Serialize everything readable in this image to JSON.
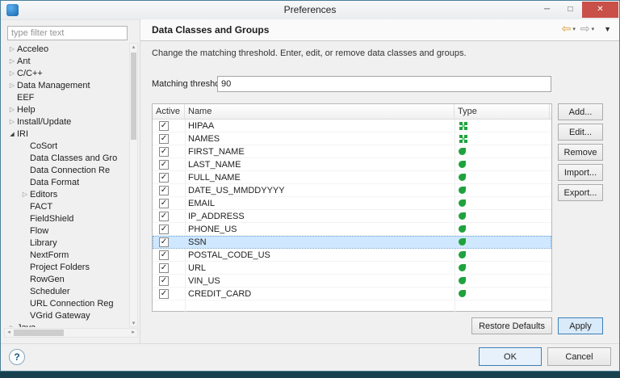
{
  "window": {
    "title": "Preferences",
    "controls": {
      "minimize": "─",
      "maximize": "□",
      "close": "✕"
    }
  },
  "icons": {
    "back": "⇦",
    "forward": "⇨",
    "caret_down": "▾",
    "view_menu": "▼",
    "help": "?",
    "check": "✓",
    "scroll_up": "▴",
    "scroll_down": "▾",
    "scroll_left": "◂",
    "scroll_right": "▸",
    "twisty_collapsed": "▷",
    "twisty_expanded": "◢"
  },
  "colors": {
    "accent": "#3e7fb6",
    "selection_bg": "#cfe8ff",
    "selection_border": "#6ba5dd",
    "class_icon_green": "#1fa23d",
    "close_button_red": "#c85048",
    "back_arrow_gold": "#d49a2a"
  },
  "sidebar": {
    "filter": {
      "value": "",
      "placeholder": "type filter text"
    },
    "tree": [
      {
        "label": "Acceleo",
        "level": 0,
        "state": "collapsed"
      },
      {
        "label": "Ant",
        "level": 0,
        "state": "collapsed"
      },
      {
        "label": "C/C++",
        "level": 0,
        "state": "collapsed"
      },
      {
        "label": "Data Management",
        "level": 0,
        "state": "collapsed"
      },
      {
        "label": "EEF",
        "level": 0,
        "state": "none"
      },
      {
        "label": "Help",
        "level": 0,
        "state": "collapsed"
      },
      {
        "label": "Install/Update",
        "level": 0,
        "state": "collapsed"
      },
      {
        "label": "IRI",
        "level": 0,
        "state": "expanded"
      },
      {
        "label": "CoSort",
        "level": 1,
        "state": "none"
      },
      {
        "label": "Data Classes and Gro",
        "level": 1,
        "state": "none"
      },
      {
        "label": "Data Connection Re",
        "level": 1,
        "state": "none"
      },
      {
        "label": "Data Format",
        "level": 1,
        "state": "none"
      },
      {
        "label": "Editors",
        "level": 1,
        "state": "collapsed"
      },
      {
        "label": "FACT",
        "level": 1,
        "state": "none"
      },
      {
        "label": "FieldShield",
        "level": 1,
        "state": "none"
      },
      {
        "label": "Flow",
        "level": 1,
        "state": "none"
      },
      {
        "label": "Library",
        "level": 1,
        "state": "none"
      },
      {
        "label": "NextForm",
        "level": 1,
        "state": "none"
      },
      {
        "label": "Project Folders",
        "level": 1,
        "state": "none"
      },
      {
        "label": "RowGen",
        "level": 1,
        "state": "none"
      },
      {
        "label": "Scheduler",
        "level": 1,
        "state": "none"
      },
      {
        "label": "URL Connection Reg",
        "level": 1,
        "state": "none"
      },
      {
        "label": "VGrid Gateway",
        "level": 1,
        "state": "none"
      },
      {
        "label": "Java",
        "level": 0,
        "state": "collapsed"
      }
    ]
  },
  "main": {
    "title": "Data Classes and Groups",
    "description": "Change the matching threshold. Enter, edit, or remove data classes and groups.",
    "threshold": {
      "label": "Matching threshold:",
      "value": "90"
    },
    "table": {
      "columns": [
        "Active",
        "Name",
        "Type"
      ],
      "rows": [
        {
          "name": "HIPAA",
          "active": true,
          "type": "group"
        },
        {
          "name": "NAMES",
          "active": true,
          "type": "group"
        },
        {
          "name": "FIRST_NAME",
          "active": true,
          "type": "class"
        },
        {
          "name": "LAST_NAME",
          "active": true,
          "type": "class"
        },
        {
          "name": "FULL_NAME",
          "active": true,
          "type": "class"
        },
        {
          "name": "DATE_US_MMDDYYYY",
          "active": true,
          "type": "class"
        },
        {
          "name": "EMAIL",
          "active": true,
          "type": "class"
        },
        {
          "name": "IP_ADDRESS",
          "active": true,
          "type": "class"
        },
        {
          "name": "PHONE_US",
          "active": true,
          "type": "class"
        },
        {
          "name": "SSN",
          "active": true,
          "type": "class",
          "selected": true
        },
        {
          "name": "POSTAL_CODE_US",
          "active": true,
          "type": "class"
        },
        {
          "name": "URL",
          "active": true,
          "type": "class"
        },
        {
          "name": "VIN_US",
          "active": true,
          "type": "class"
        },
        {
          "name": "CREDIT_CARD",
          "active": true,
          "type": "class"
        }
      ]
    },
    "side_buttons": [
      {
        "name": "add-button",
        "label": "Add..."
      },
      {
        "name": "edit-button",
        "label": "Edit..."
      },
      {
        "name": "remove-button",
        "label": "Remove"
      },
      {
        "name": "import-button",
        "label": "Import..."
      },
      {
        "name": "export-button",
        "label": "Export..."
      }
    ],
    "restore_defaults_label": "Restore Defaults",
    "apply_label": "Apply"
  },
  "footer": {
    "ok_label": "OK",
    "cancel_label": "Cancel"
  }
}
